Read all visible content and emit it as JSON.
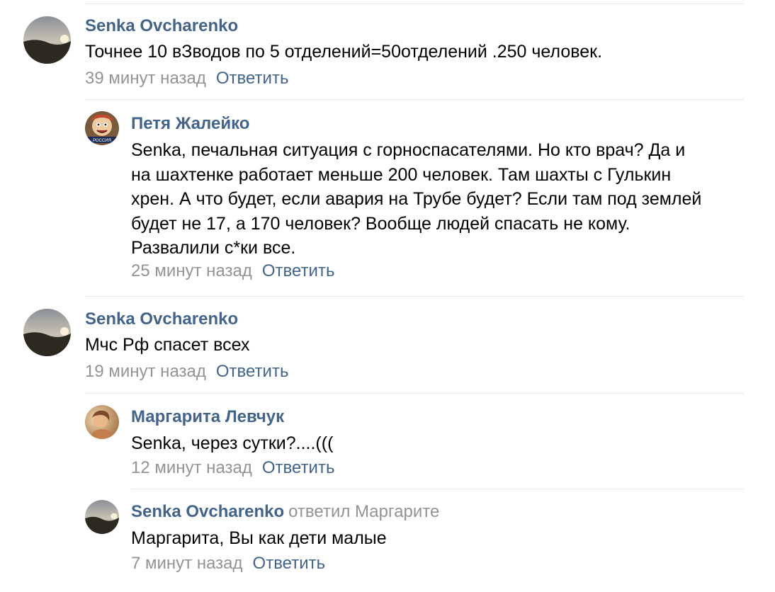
{
  "comments": [
    {
      "author": "Senka Ovcharenko",
      "text": "Точнее 10 вЗводов по 5 отделений=50отделений .250 человек.",
      "time": "39 минут назад",
      "reply": "Ответить"
    },
    {
      "author": "Петя Жалейко",
      "text": "Senka, печальная ситуация с горноспасателями. Но кто врач? Да и\nна шахтенке работает меньше 200 человек. Там шахты с Гулькин\nхрен. А что будет, если авария на Трубе будет? Если там под землей\nбудет не 17, а 170 человек? Вообще людей спасать не кому.\nРазвалили с*ки все.",
      "time": "25 минут назад",
      "reply": "Ответить",
      "avatar_badge": "РОССИЯ"
    },
    {
      "author": "Senka Ovcharenko",
      "text": "Мчс Рф спасет всех",
      "time": "19 минут назад",
      "reply": "Ответить"
    },
    {
      "author": "Маргарита Левчук",
      "text": "Senka, через сутки?....(((",
      "time": "12 минут назад",
      "reply": "Ответить"
    },
    {
      "author": "Senka Ovcharenko",
      "replied_to": "ответил Маргарите",
      "text": "Маргарита, Вы как дети малые",
      "time": "7 минут назад",
      "reply": "Ответить"
    }
  ],
  "colors": {
    "link": "#42648b",
    "muted": "#939393",
    "separator": "#e7e8ec"
  },
  "icons": {
    "avatar_1": "sunset-landscape-avatar",
    "avatar_2": "cartoon-face-avatar",
    "avatar_3": "sunset-landscape-avatar",
    "avatar_4": "portrait-photo-avatar",
    "avatar_5": "sunset-landscape-avatar"
  }
}
